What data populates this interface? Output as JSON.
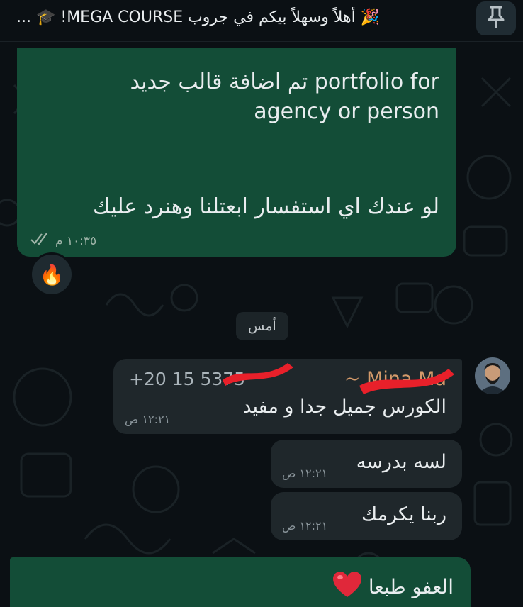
{
  "pinned": {
    "text": "🎉 أهلاً وسهلاً بيكم في جروب MEGA COURSE! 🎓 ...",
    "icon": "pin-icon"
  },
  "outgoing_message": {
    "line1": "تم اضافة قالب جديد  portfolio for",
    "line2": "agency or person",
    "line3": "لو عندك اي استفسار ابعتلنا وهنرد عليك",
    "time": "١٠:٣٥ م",
    "status_icon": "double-check-icon",
    "reaction": "🔥"
  },
  "date_separator": "أمس",
  "incoming_messages": [
    {
      "sender_phone": "+20 15 5375",
      "sender_name": "~ Mina Ma",
      "text": "الكورس جميل جدا و مفيد",
      "time": "١٢:٢١ ص"
    },
    {
      "text": "لسه بدرسه",
      "time": "١٢:٢١ ص"
    },
    {
      "text": "ربنا يكرمك",
      "time": "١٢:٢١ ص"
    }
  ],
  "reply_message": {
    "text": "العفو طبعا",
    "emoji": "❤️"
  },
  "colors": {
    "background": "#0b1014",
    "outgoing_bubble": "#134d37",
    "incoming_bubble": "#1f272b",
    "sender_name": "#d49a6a",
    "redaction": "#e8202a"
  }
}
